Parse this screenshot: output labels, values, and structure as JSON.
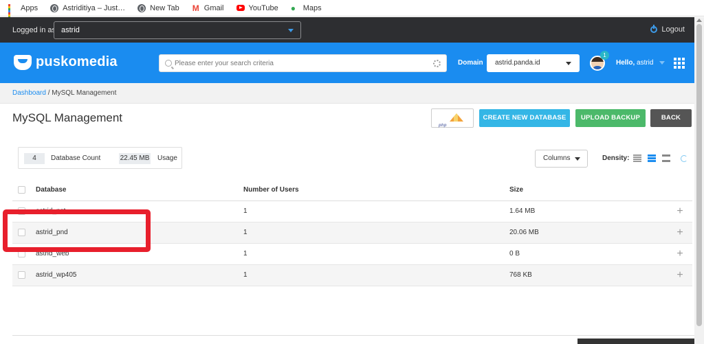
{
  "bookmarks": [
    {
      "label": "Apps",
      "icon": "apps-grid-icon"
    },
    {
      "label": "Astriditiya – Just…",
      "icon": "globe-icon"
    },
    {
      "label": "New Tab",
      "icon": "globe-icon"
    },
    {
      "label": "Gmail",
      "icon": "gmail-icon"
    },
    {
      "label": "YouTube",
      "icon": "youtube-icon"
    },
    {
      "label": "Maps",
      "icon": "maps-icon"
    }
  ],
  "topbar": {
    "logged_in_label": "Logged in as",
    "user": "astrid",
    "logout_label": "Logout"
  },
  "header": {
    "brand": "puskomedia",
    "search_placeholder": "Please enter your search criteria",
    "domain_label": "Domain",
    "domain_value": "astrid.panda.id",
    "notification_count": "1",
    "hello_prefix": "Hello,",
    "hello_user": "astrid"
  },
  "breadcrumb": {
    "home": "Dashboard",
    "separator": " / ",
    "current": "MySQL Management"
  },
  "page": {
    "title": "MySQL Management",
    "buttons": {
      "phpmyadmin": "phpMyAdmin",
      "create": "CREATE NEW DATABASE",
      "upload": "UPLOAD BACKUP",
      "back": "BACK"
    }
  },
  "stats": {
    "db_count": "4",
    "db_count_label": "Database Count",
    "usage": "22.45 MB",
    "usage_label": "Usage"
  },
  "toolbar": {
    "columns_label": "Columns",
    "density_label": "Density:"
  },
  "table": {
    "headers": {
      "database": "Database",
      "users": "Number of Users",
      "size": "Size"
    },
    "rows": [
      {
        "database": "astrid_pst",
        "users": "1",
        "size": "1.64 MB"
      },
      {
        "database": "astrid_pnd",
        "users": "1",
        "size": "20.06 MB"
      },
      {
        "database": "astrid_web",
        "users": "1",
        "size": "0 B"
      },
      {
        "database": "astrid_wp405",
        "users": "1",
        "size": "768 KB"
      }
    ]
  },
  "colors": {
    "header_blue": "#1a8cf0",
    "create_button": "#34b6e6",
    "upload_button": "#4cb96a",
    "back_button": "#555555",
    "highlight_red": "#e81f2c"
  }
}
